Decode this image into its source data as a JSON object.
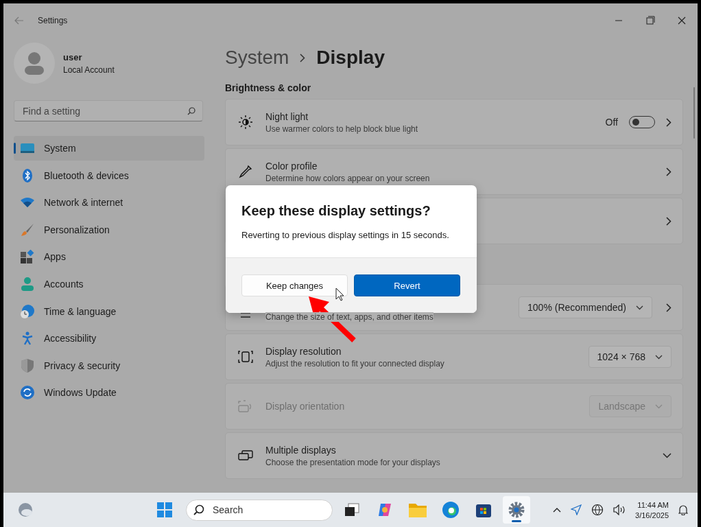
{
  "window": {
    "title": "Settings"
  },
  "account": {
    "name": "user",
    "type": "Local Account"
  },
  "search": {
    "placeholder": "Find a setting"
  },
  "nav": [
    {
      "label": "System",
      "selected": true
    },
    {
      "label": "Bluetooth & devices",
      "selected": false
    },
    {
      "label": "Network & internet",
      "selected": false
    },
    {
      "label": "Personalization",
      "selected": false
    },
    {
      "label": "Apps",
      "selected": false
    },
    {
      "label": "Accounts",
      "selected": false
    },
    {
      "label": "Time & language",
      "selected": false
    },
    {
      "label": "Accessibility",
      "selected": false
    },
    {
      "label": "Privacy & security",
      "selected": false
    },
    {
      "label": "Windows Update",
      "selected": false
    }
  ],
  "breadcrumb": [
    "System",
    "Display"
  ],
  "section": "Brightness & color",
  "cards": [
    {
      "kind": "toggle",
      "title": "Night light",
      "subtitle": "Use warmer colors to help block blue light",
      "value": "Off",
      "on": false,
      "disabled": false
    },
    {
      "kind": "link",
      "title": "Color profile",
      "subtitle": "Determine how colors appear on your screen",
      "disabled": false
    },
    {
      "kind": "link",
      "disabled": false
    },
    {
      "kind": "gap"
    },
    {
      "kind": "dropdown-link",
      "subtitle": "Change the size of text, apps, and other items",
      "value": "100% (Recommended)",
      "disabled": false
    },
    {
      "kind": "dropdown",
      "title": "Display resolution",
      "subtitle": "Adjust the resolution to fit your connected display",
      "value": "1024 × 768",
      "disabled": false
    },
    {
      "kind": "dropdown",
      "title": "Display orientation",
      "value": "Landscape",
      "disabled": true
    },
    {
      "kind": "expander",
      "title": "Multiple displays",
      "subtitle": "Choose the presentation mode for your displays",
      "disabled": false
    }
  ],
  "dialog": {
    "title": "Keep these display settings?",
    "message": "Reverting to previous display settings in 15 seconds.",
    "buttons": [
      {
        "label": "Keep changes",
        "primary": false
      },
      {
        "label": "Revert",
        "primary": true
      }
    ]
  },
  "taskbar": {
    "search": {
      "placeholder": "Search"
    },
    "apps": [
      {
        "selected": false
      },
      {
        "selected": false
      },
      {
        "selected": false
      },
      {
        "selected": false
      },
      {
        "selected": false
      },
      {
        "selected": true
      }
    ],
    "time": "11:44 AM",
    "date": "3/16/2025"
  }
}
